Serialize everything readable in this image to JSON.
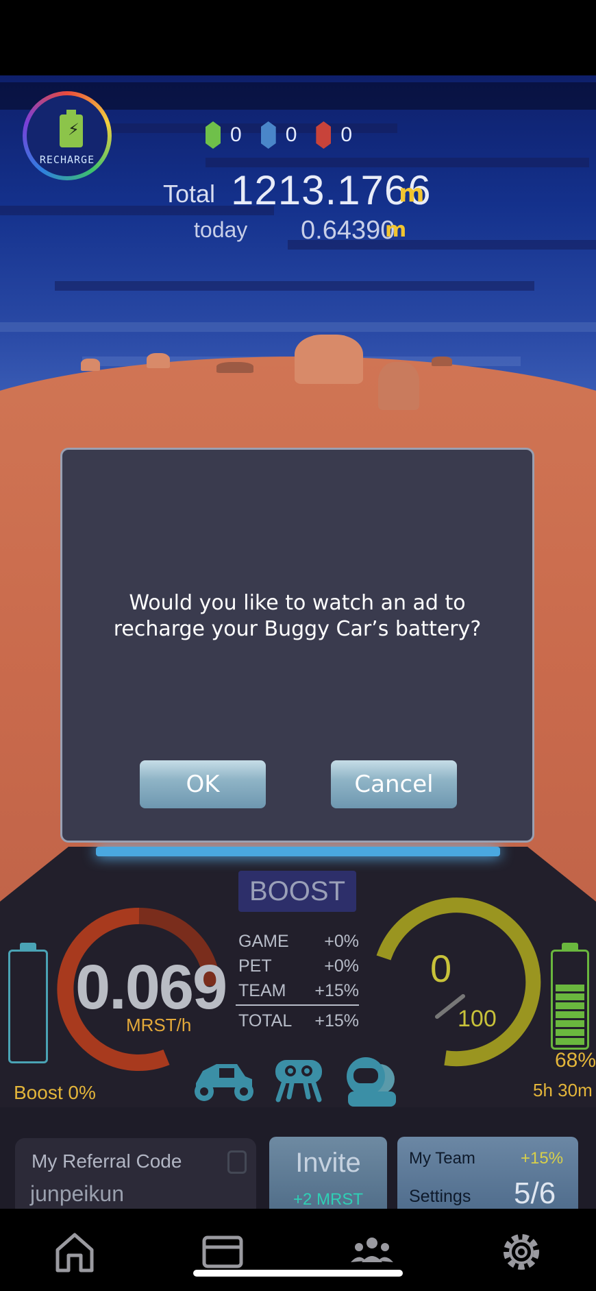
{
  "recharge": {
    "label": "RECHARGE"
  },
  "gems": [
    {
      "color": "#6fc04a",
      "count": "0"
    },
    {
      "color": "#4a86c9",
      "count": "0"
    },
    {
      "color": "#c8433a",
      "count": "0"
    }
  ],
  "totals": {
    "total_label": "Total",
    "total_value": "1213.1766",
    "unit": "m",
    "today_label": "today",
    "today_value": "0.64390"
  },
  "dialog": {
    "message": "Would you like to watch an ad to recharge your Buggy Car’s battery?",
    "ok_label": "OK",
    "cancel_label": "Cancel"
  },
  "dashboard": {
    "boost_title": "BOOST",
    "speed_value": "0.069",
    "speed_unit": "MRST/h",
    "boost_pct": "Boost 0%",
    "stats": [
      {
        "label": "GAME",
        "value": "+0%"
      },
      {
        "label": "PET",
        "value": "+0%"
      },
      {
        "label": "TEAM",
        "value": "+15%"
      }
    ],
    "total_stat": {
      "label": "TOTAL",
      "value": "+15%"
    },
    "gauge_value": "0",
    "gauge_max": "100",
    "battery_level": 0.68,
    "battery_pct": "68%",
    "time_left": "5h 30m"
  },
  "cards": {
    "referral_label": "My Referral Code",
    "referral_code": "junpeikun",
    "invite_label": "Invite",
    "invite_reward": "+2 MRST",
    "team_label": "My Team",
    "team_bonus": "+15%",
    "team_settings": "Settings",
    "team_count": "5/6"
  },
  "nav": [
    "home-icon",
    "card-icon",
    "team-icon",
    "gear-icon"
  ]
}
